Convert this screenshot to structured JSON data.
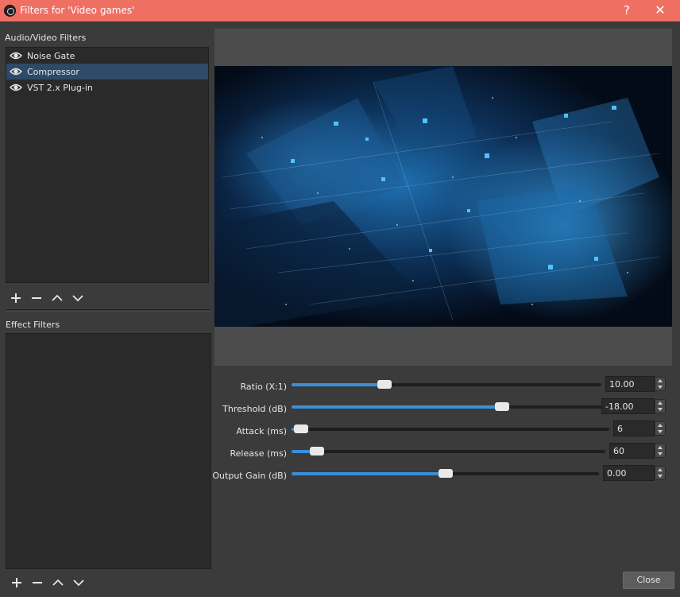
{
  "window": {
    "title": "Filters for 'Video games'",
    "help_label": "?",
    "close_label": "✕"
  },
  "audio_video": {
    "header": "Audio/Video Filters",
    "items": [
      {
        "label": "Noise Gate",
        "selected": false
      },
      {
        "label": "Compressor",
        "selected": true
      },
      {
        "label": "VST 2.x Plug-in",
        "selected": false
      }
    ]
  },
  "effect": {
    "header": "Effect Filters",
    "items": []
  },
  "params": [
    {
      "label": "Ratio (X:1)",
      "value": "10.00",
      "level": 0.3
    },
    {
      "label": "Threshold (dB)",
      "value": "-18.00",
      "level": 0.68
    },
    {
      "label": "Attack (ms)",
      "value": "6",
      "level": 0.03
    },
    {
      "label": "Release (ms)",
      "value": "60",
      "level": 0.08
    },
    {
      "label": "Output Gain (dB)",
      "value": "0.00",
      "level": 0.5
    }
  ],
  "close_button": "Close",
  "colors": {
    "titlebar": "#f06f63",
    "accent": "#3a8fd9",
    "selection": "#2d4a66"
  }
}
